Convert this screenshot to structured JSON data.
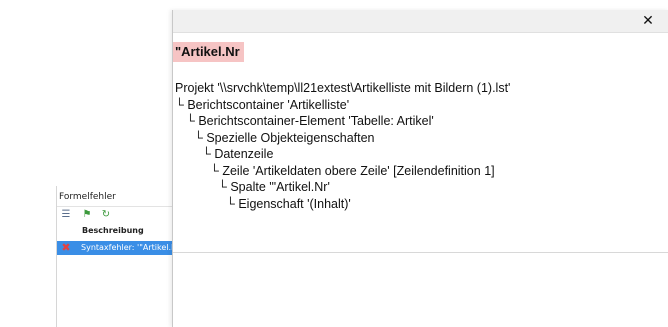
{
  "error_panel": {
    "title": "Formelfehler",
    "column_header": "Beschreibung",
    "rows": [
      {
        "label": "Syntaxfehler: '\"Artikel.N"
      }
    ],
    "toolbar_icons": [
      "list-icon",
      "flag-icon",
      "refresh-icon"
    ]
  },
  "popup": {
    "close_symbol": "✕",
    "field_name": "\"Artikel.Nr",
    "tree": [
      "Projekt '\\\\srvchk\\temp\\ll21extest\\Artikelliste mit Bildern (1).lst'",
      "└ Berichtscontainer 'Artikelliste'",
      "└ Berichtscontainer-Element 'Tabelle: Artikel'",
      "└ Spezielle Objekteigenschaften",
      "└ Datenzeile",
      "└ Zeile 'Artikeldaten obere Zeile' [Zeilendefinition  1]",
      "└ Spalte '\"Artikel.Nr'",
      "└ Eigenschaft '(Inhalt)'"
    ]
  },
  "colors": {
    "highlight": "#f6c4c4",
    "selection": "#3a8ee6",
    "error": "#e34242"
  }
}
